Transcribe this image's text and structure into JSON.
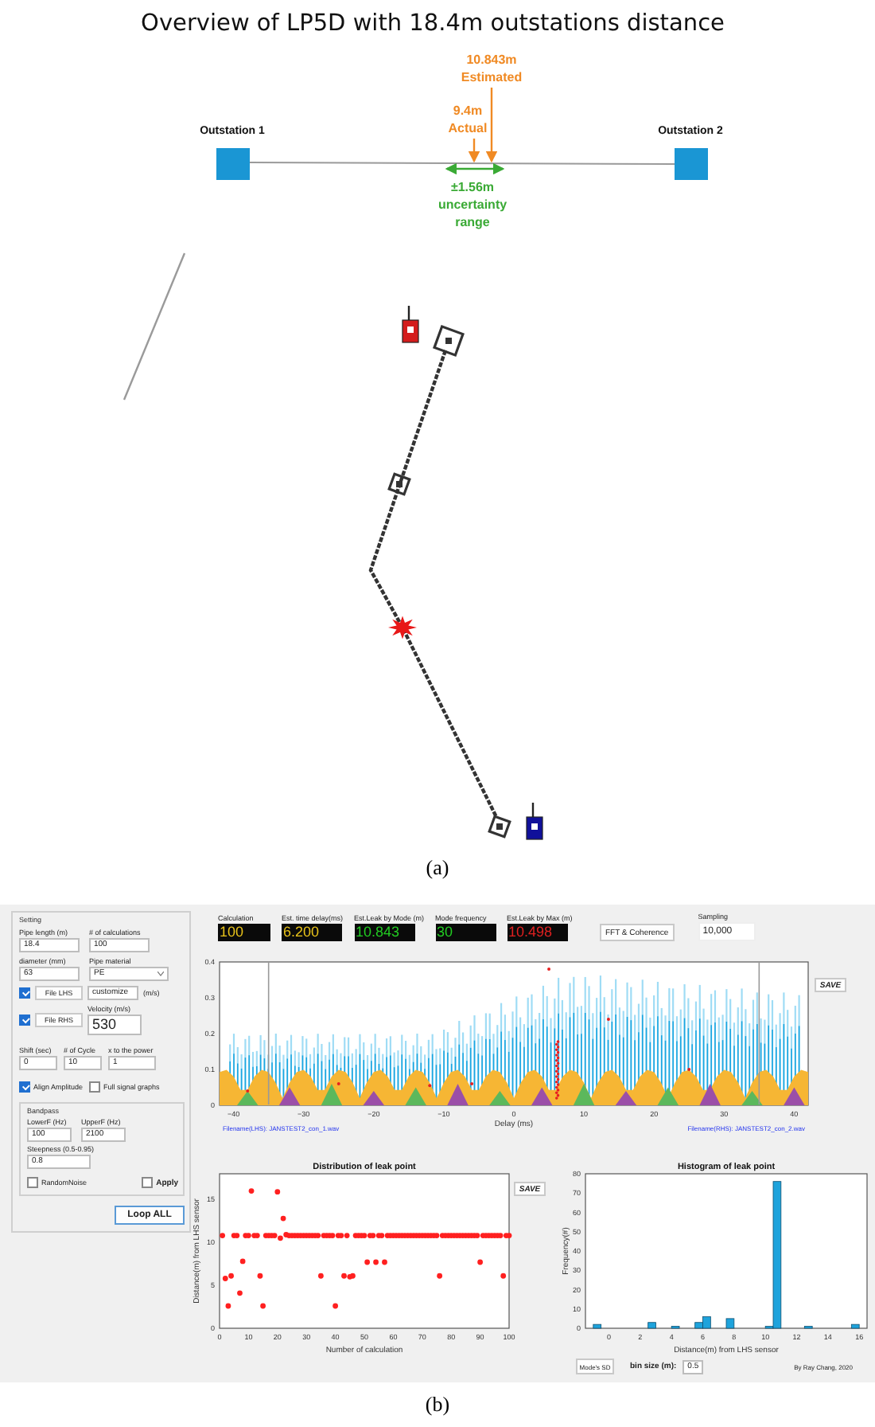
{
  "figure_a": {
    "title": "Overview of LP5D with 18.4m outstations distance",
    "outstations": [
      {
        "label": "Outstation 1"
      },
      {
        "label": "Outstation 2"
      }
    ],
    "annotations": [
      {
        "kind": "estimated",
        "lines": [
          "10.843m",
          "Estimated"
        ]
      },
      {
        "kind": "actual",
        "lines": [
          "9.4m",
          "Actual"
        ]
      },
      {
        "kind": "range",
        "lines": [
          "±1.56m",
          "uncertainty",
          "range"
        ]
      }
    ],
    "caption": "(a)"
  },
  "app": {
    "settings": {
      "group_label": "Setting",
      "pipe_length": {
        "label": "Pipe length (m)",
        "value": "18.4"
      },
      "calculations": {
        "label": "# of calculations",
        "value": "100"
      },
      "diameter": {
        "label": "diameter (mm)",
        "value": "63"
      },
      "pipe_material": {
        "label": "Pipe material",
        "value": "PE"
      },
      "file_lhs": {
        "checked": true,
        "button": "File LHS"
      },
      "file_rhs": {
        "checked": true,
        "button": "File RHS"
      },
      "velocity_mode": {
        "value": "customize",
        "unit": "(m/s)"
      },
      "velocity": {
        "label": "Velocity (m/s)",
        "value": "530"
      },
      "shift": {
        "label": "Shift (sec)",
        "value": "0"
      },
      "cycles": {
        "label": "# of Cycle",
        "value": "10"
      },
      "power": {
        "label": "x to the power",
        "value": "1"
      },
      "align_amplitude": {
        "label": "Align Amplitude",
        "checked": true
      },
      "full_signal_graphs": {
        "label": "Full signal graphs",
        "checked": false
      },
      "bandpass": {
        "group_label": "Bandpass",
        "lower": {
          "label": "LowerF (Hz)",
          "value": "100"
        },
        "upper": {
          "label": "UpperF (Hz)",
          "value": "2100"
        },
        "steepness": {
          "label": "Steepness (0.5-0.95)",
          "value": "0.8"
        },
        "random_noise": {
          "label": "RandomNoise",
          "checked": false
        },
        "apply": {
          "label": "Apply",
          "checked": false
        }
      },
      "loop_button": "Loop ALL"
    },
    "readouts": [
      {
        "label": "Calculation",
        "value": "100",
        "kind": "timing"
      },
      {
        "label": "Est. time delay(ms)",
        "value": "6.200",
        "kind": "timing"
      },
      {
        "label": "Est.Leak by Mode (m)",
        "value": "10.843",
        "kind": "mode"
      },
      {
        "label": "Mode frequency",
        "value": "30",
        "kind": "mode"
      },
      {
        "label": "Est.Leak by Max (m)",
        "value": "10.498",
        "kind": "max"
      }
    ],
    "fft_button": "FFT & Coherence",
    "sampling": {
      "label": "Sampling",
      "value": "10,000"
    },
    "correlation_plot": {
      "yticks": [
        "0.4",
        "0.3",
        "0.2",
        "0.1",
        "0"
      ],
      "xticks": [
        "−40",
        "−30",
        "−20",
        "−10",
        "0",
        "10",
        "20",
        "30",
        "40"
      ],
      "xlabel": "Delay (ms)",
      "save": "SAVE",
      "file_lhs": "Filename(LHS): JANSTEST2_con_1.wav",
      "file_rhs": "Filename(RHS): JANSTEST2_con_2.wav"
    },
    "distribution_plot": {
      "save": "SAVE",
      "chart_data": {
        "type": "scatter",
        "title": "Distribution of leak point",
        "xlabel": "Number of calculation",
        "ylabel": "Distance(m) from LHS sensor",
        "x": [
          1,
          2,
          3,
          4,
          5,
          6,
          7,
          8,
          9,
          10,
          11,
          12,
          13,
          14,
          15,
          16,
          17,
          18,
          19,
          20,
          21,
          22,
          23,
          24,
          25,
          26,
          27,
          28,
          29,
          30,
          31,
          32,
          33,
          34,
          35,
          36,
          37,
          38,
          39,
          40,
          41,
          42,
          43,
          44,
          45,
          46,
          47,
          48,
          49,
          50,
          51,
          52,
          53,
          54,
          55,
          56,
          57,
          58,
          59,
          60,
          61,
          62,
          63,
          64,
          65,
          66,
          67,
          68,
          69,
          70,
          71,
          72,
          73,
          74,
          75,
          76,
          77,
          78,
          79,
          80,
          81,
          82,
          83,
          84,
          85,
          86,
          87,
          88,
          89,
          90,
          91,
          92,
          93,
          94,
          95,
          96,
          97,
          98,
          99,
          100
        ],
        "values": [
          10.8,
          5.8,
          2.6,
          6.1,
          10.8,
          10.8,
          4.1,
          7.8,
          10.8,
          10.8,
          16,
          10.8,
          10.8,
          6.1,
          2.6,
          10.8,
          10.8,
          10.8,
          10.8,
          15.9,
          10.5,
          12.8,
          10.9,
          10.8,
          10.8,
          10.8,
          10.8,
          10.8,
          10.8,
          10.8,
          10.8,
          10.8,
          10.8,
          10.8,
          6.1,
          10.8,
          10.8,
          10.8,
          10.8,
          2.6,
          10.8,
          10.8,
          6.1,
          10.8,
          6.0,
          6.1,
          10.8,
          10.8,
          10.8,
          10.8,
          7.7,
          10.8,
          10.8,
          7.7,
          10.8,
          10.8,
          7.7,
          10.8,
          10.8,
          10.8,
          10.8,
          10.8,
          10.8,
          10.8,
          10.8,
          10.8,
          10.8,
          10.8,
          10.8,
          10.8,
          10.8,
          10.8,
          10.8,
          10.8,
          10.8,
          6.1,
          10.8,
          10.8,
          10.8,
          10.8,
          10.8,
          10.8,
          10.8,
          10.8,
          10.8,
          10.8,
          10.8,
          10.8,
          10.8,
          7.7,
          10.8,
          10.8,
          10.8,
          10.8,
          10.8,
          10.8,
          10.8,
          6.1,
          10.8,
          10.8
        ],
        "xlim": [
          0,
          100
        ],
        "ylim": [
          0,
          18
        ],
        "xticks": [
          0,
          10,
          20,
          30,
          40,
          50,
          60,
          70,
          80,
          90,
          100
        ],
        "yticks": [
          0,
          5,
          10,
          15
        ]
      }
    },
    "histogram": {
      "chart_data": {
        "type": "bar",
        "title": "Histogram of leak point",
        "xlabel": "Distance(m) from LHS sensor",
        "ylabel": "Frequency(#)",
        "x": [
          -0.75,
          2.75,
          4.25,
          5.75,
          6.25,
          7.75,
          10.25,
          10.75,
          12.75,
          15.75
        ],
        "values": [
          2,
          3,
          1,
          3,
          6,
          5,
          1,
          76,
          1,
          2
        ],
        "xlim": [
          -1.5,
          16.5
        ],
        "ylim": [
          0,
          80
        ],
        "xticks": [
          0,
          2,
          4,
          6,
          8,
          10,
          12,
          14,
          16
        ],
        "yticks": [
          0,
          10,
          20,
          30,
          40,
          50,
          60,
          70,
          80
        ]
      }
    },
    "mode_sd_button": "Mode's SD",
    "bin_size": {
      "label": "bin size (m):",
      "value": "0.5"
    },
    "credit": "By Ray Chang, 2020"
  },
  "caption_b": "(b)"
}
